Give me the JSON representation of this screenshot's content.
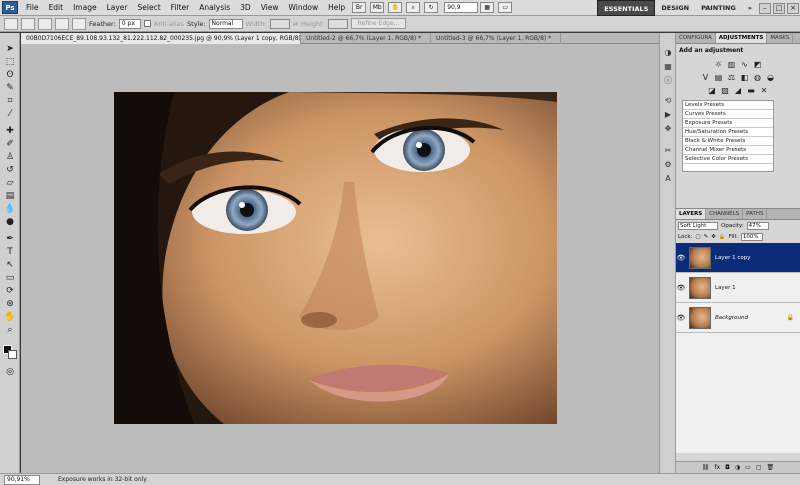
{
  "menu": {
    "app_logo": "Ps",
    "items": [
      "File",
      "Edit",
      "Image",
      "Layer",
      "Select",
      "Filter",
      "Analysis",
      "3D",
      "View",
      "Window",
      "Help"
    ],
    "zoom": "90,9",
    "workspaces": [
      "ESSENTIALS",
      "DESIGN",
      "PAINTING"
    ]
  },
  "options": {
    "feather_label": "Feather:",
    "feather_value": "0 px",
    "antialias_label": "Anti-alias",
    "style_label": "Style:",
    "style_value": "Normal",
    "width_label": "Width:",
    "height_label": "Height:",
    "refine_label": "Refine Edge..."
  },
  "doc_tabs": [
    "00B0D7106ECE_89.108.93.132_81.222.112.82_000235.jpg @ 90,9% (Layer 1 copy, RGB/8) *",
    "Untitled-2 @ 66,7% (Layer 1, RGB/8) *",
    "Untitled-3 @ 66,7% (Layer 1, RGB/8) *"
  ],
  "status": {
    "zoom": "90,91%",
    "message": "Exposure works in 32-bit only"
  },
  "panels": {
    "top_tabs": [
      "CONFIGURA",
      "ADJUSTMENTS",
      "MASKS"
    ],
    "adjustments_title": "Add an adjustment",
    "presets": [
      "Levels Presets",
      "Curves Presets",
      "Exposure Presets",
      "Hue/Saturation Presets",
      "Black & White Presets",
      "Channel Mixer Presets",
      "Selective Color Presets"
    ],
    "layer_tabs": [
      "LAYERS",
      "CHANNELS",
      "PATHS"
    ],
    "blend_mode": "Soft Light",
    "opacity_label": "Opacity:",
    "opacity_value": "47%",
    "lock_label": "Lock:",
    "fill_label": "Fill:",
    "fill_value": "100%",
    "layers": [
      "Layer 1 copy",
      "Layer 1",
      "Background"
    ]
  }
}
